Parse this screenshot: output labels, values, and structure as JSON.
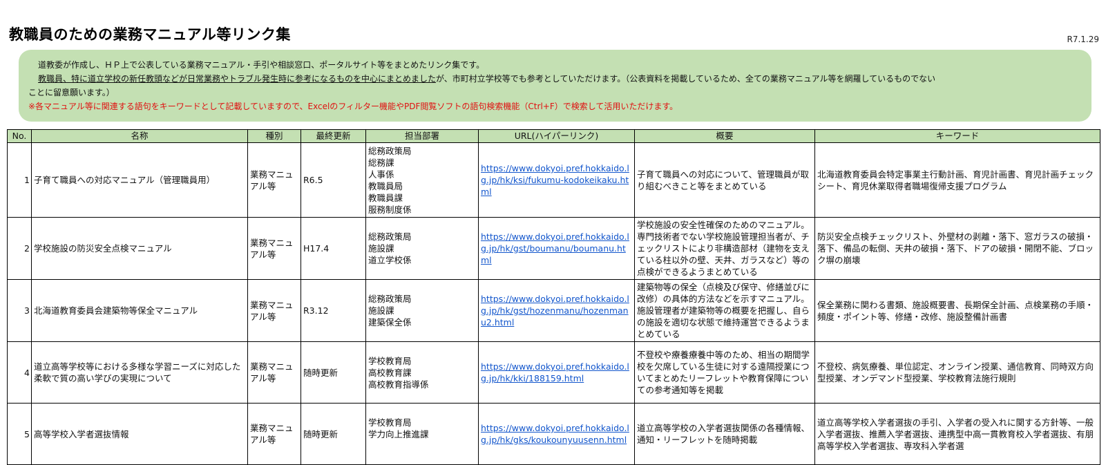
{
  "title": "教職員のための業務マニュアル等リンク集",
  "date": "R7.1.29",
  "notice": {
    "line1": "道教委が作成し、ＨＰ上で公表している業務マニュアル・手引や相談窓口、ポータルサイト等をまとめたリンク集です。",
    "line2_underlined": "教職員、特に道立学校の新任教頭などが日常業務やトラブル発生時に参考になるものを中心にまとめました",
    "line2_rest": "が、市町村立学校等でも参考としていただけます。（公表資料を掲載しているため、全ての業務マニュアル等を網羅しているものでない",
    "line3": "ことに留意願います。）",
    "line4": "※各マニュアル等に関連する語句をキーワードとして記載していますので、Excelのフィルター機能やPDF閲覧ソフトの語句検索機能（Ctrl+F）で検索して活用いただけます。"
  },
  "table": {
    "headers": [
      "No.",
      "名称",
      "種別",
      "最終更新",
      "担当部署",
      "URL(ハイパーリンク)",
      "概要",
      "キーワード"
    ],
    "rows": [
      {
        "no": "1",
        "name": "子育て職員への対応マニュアル（管理職員用）",
        "type": "業務マニュアル等",
        "updated": "R6.5",
        "dept": [
          "総務政策局",
          "総務課",
          "人事係",
          "教職員局",
          "教職員課",
          "服務制度係"
        ],
        "url": "https://www.dokyoi.pref.hokkaido.lg.jp/hk/ksi/fukumu-kodokeikaku.html",
        "summary": "子育て職員への対応について、管理職員が取り組むべきこと等をまとめている",
        "keywords": "北海道教育委員会特定事業主行動計画、育児計画書、育児計画チェックシート、育児休業取得者職場復帰支援プログラム"
      },
      {
        "no": "2",
        "name": "学校施設の防災安全点検マニュアル",
        "type": "業務マニュアル等",
        "updated": "H17.4",
        "dept": [
          "総務政策局",
          "施設課",
          "道立学校係"
        ],
        "url": "https://www.dokyoi.pref.hokkaido.lg.jp/hk/gst/boumanu/boumanu.html",
        "summary": "学校施設の安全性確保のためのマニュアル。専門技術者でない学校施設管理担当者が、チェックリストにより非構造部材（建物を支えている柱以外の壁、天井、ガラスなど）等の点検ができるようまとめている",
        "keywords": "防災安全点検チェックリスト、外壁材の剥離・落下、窓ガラスの破損・落下、備品の転倒、天井の破損・落下、ドアの破損・開閉不能、ブロック塀の崩壊"
      },
      {
        "no": "3",
        "name": "北海道教育委員会建築物等保全マニュアル",
        "type": "業務マニュアル等",
        "updated": "R3.12",
        "dept": [
          "総務政策局",
          "施設課",
          "建築保全係"
        ],
        "url": "https://www.dokyoi.pref.hokkaido.lg.jp/hk/gst/hozenmanu/hozenmanu2.html",
        "summary": "建築物等の保全（点検及び保守、修繕並びに改修）の具体的方法などを示すマニュアル。施設管理者が建築物等の概要を把握し、自らの施設を適切な状態で維持運営できるようまとめている",
        "keywords": "保全業務に関わる書類、施設概要書、長期保全計画、点検業務の手順・頻度・ポイント等、修繕・改修、施設整備計画書"
      },
      {
        "no": "4",
        "name": "道立高等学校等における多様な学習ニーズに対応した柔軟で質の高い学びの実現について",
        "type": "業務マニュアル等",
        "updated": "随時更新",
        "dept": [
          "学校教育局",
          "高校教育課",
          "高校教育指導係"
        ],
        "url": "https://www.dokyoi.pref.hokkaido.lg.jp/hk/kki/188159.html",
        "summary": "不登校や療養療養中等のため、相当の期間学校を欠席している生徒に対する遠隔授業についてまとめたリーフレットや教育保障についての参考通知等を掲載",
        "keywords": "不登校、病気療養、単位認定、オンライン授業、通信教育、同時双方向型授業、オンデマンド型授業、学校教育法施行規則"
      },
      {
        "no": "5",
        "name": "高等学校入学者選抜情報",
        "type": "業務マニュアル等",
        "updated": "随時更新",
        "dept": [
          "学校教育局",
          "学力向上推進課",
          ""
        ],
        "url": "https://www.dokyoi.pref.hokkaido.lg.jp/hk/gks/koukounyuusenn.html",
        "summary": "道立高等学校の入学者選抜関係の各種情報、通知・リーフレットを随時掲載",
        "keywords": "道立高等学校入学者選抜の手引、入学者の受入れに関する方針等、一般入学者選抜、推薦入学者選抜、連携型中高一貫教育校入学者選抜、有朋高等学校入学者選抜、専攻科入学者選"
      }
    ]
  }
}
